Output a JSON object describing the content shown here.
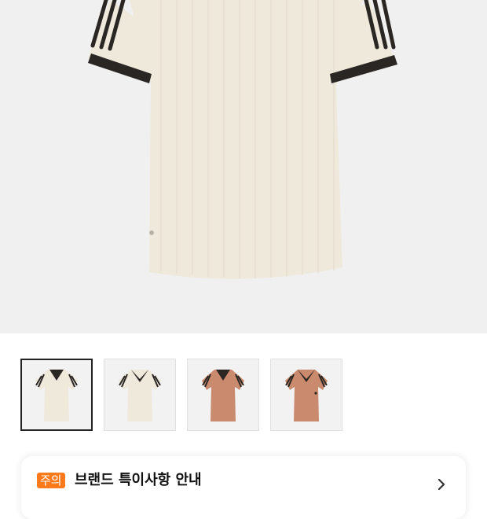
{
  "hero": {
    "image": "product-photo-cream-knit-polo-shirt-black-stripes"
  },
  "thumbnails": [
    {
      "image": "cream-polo-front",
      "shirt_color": "#efe9dc",
      "selected": true
    },
    {
      "image": "cream-polo-alt",
      "shirt_color": "#efe9dc",
      "selected": false
    },
    {
      "image": "clay-polo-front",
      "shirt_color": "#c98a6e",
      "selected": false
    },
    {
      "image": "clay-polo-alt",
      "shirt_color": "#c98a6e",
      "selected": false
    }
  ],
  "notice": {
    "badge": "주의",
    "title": "브랜드 특이사항 안내",
    "icon": "chevron-right-icon"
  },
  "colors": {
    "accent": "#ff7a1a",
    "cream": "#efe9dc",
    "clay": "#c98a6e",
    "stripe": "#222222"
  }
}
